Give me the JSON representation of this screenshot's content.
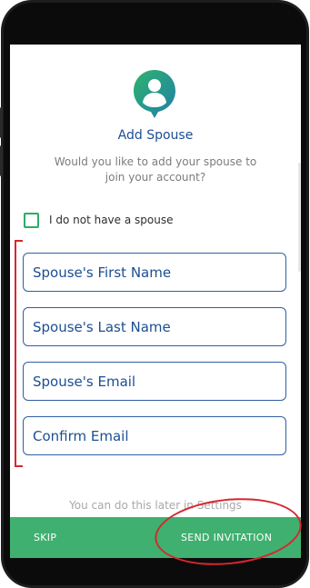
{
  "header": {
    "title": "Add Spouse",
    "subtitle": "Would you like to add your spouse to join your account?"
  },
  "checkbox": {
    "label": "I do not have a spouse",
    "checked": false
  },
  "form": {
    "first_name_placeholder": "Spouse's First Name",
    "last_name_placeholder": "Spouse's Last Name",
    "email_placeholder": "Spouse's Email",
    "confirm_email_placeholder": "Confirm Email"
  },
  "footer": {
    "later_text": "You can do this later in Settings",
    "skip_label": "SKIP",
    "send_label": "SEND INVITATION"
  },
  "colors": {
    "brand_green": "#3fb06f",
    "brand_blue": "#1c4e92",
    "annotation_red": "#d4282e"
  },
  "icons": {
    "avatar": "user-avatar-pin-icon"
  }
}
